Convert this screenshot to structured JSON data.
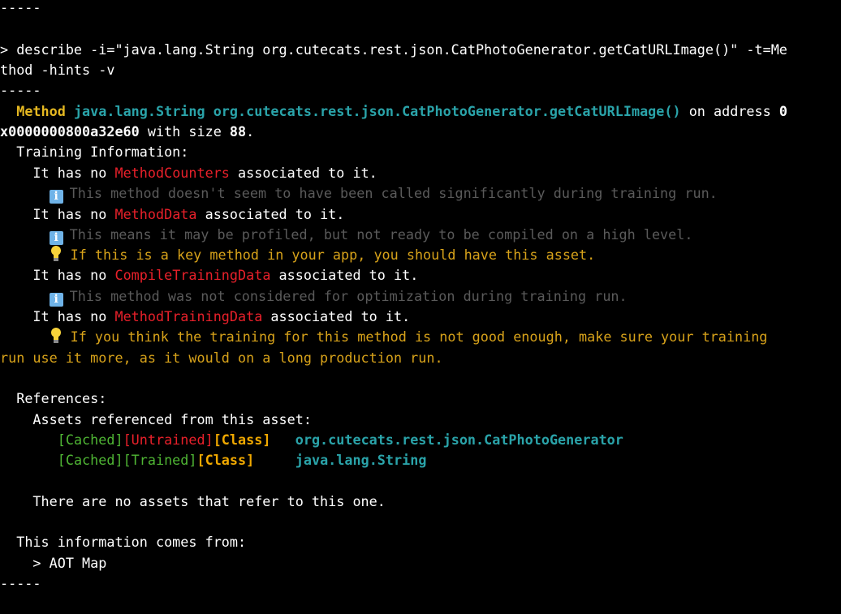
{
  "colors": {
    "background": "#000000",
    "text": "#ffffff",
    "method_keyword": "#e5b821",
    "method_name": "#2aa3a9",
    "missing_asset": "#e8202a",
    "cached_trained": "#4fb534",
    "class_tag": "#f0a800",
    "hint_text": "#5a5a5a",
    "tip_text": "#d7a21a"
  },
  "icons": {
    "info": "info-icon",
    "tip": "lightbulb-icon"
  },
  "separator_top": "-----",
  "command": {
    "line1": "> describe -i=\"java.lang.String org.cutecats.rest.json.CatPhotoGenerator.getCatURLImage()\" -t=Me",
    "line2": "thod -hints -v"
  },
  "separator_mid": "-----",
  "header": {
    "method_keyword": "Method",
    "method_signature": "java.lang.String org.cutecats.rest.json.CatPhotoGenerator.getCatURLImage()",
    "on_address_text": " on address ",
    "address_part1": "0",
    "address_part2": "x0000000800a32e60",
    "with_size_text": " with size ",
    "size": "88",
    "period": "."
  },
  "training": {
    "title": "Training Information:",
    "it_has_no": "It has no ",
    "associated": " associated to it.",
    "method_counters": {
      "name": "MethodCounters",
      "info": "This method doesn't seem to have been called significantly during training run."
    },
    "method_data": {
      "name": "MethodData",
      "info": "This means it may be profiled, but not ready to be compiled on a high level.",
      "tip": "If this is a key method in your app, you should have this asset."
    },
    "compile_training_data": {
      "name": "CompileTrainingData",
      "info": "This method was not considered for optimization during training run."
    },
    "method_training_data": {
      "name": "MethodTrainingData",
      "tip_line1": "If you think the training for this method is not good enough, make sure your training",
      "tip_line2": "run use it more, as it would on a long production run."
    }
  },
  "references": {
    "title": "References:",
    "subtitle": "Assets referenced from this asset:",
    "items": [
      {
        "cached": "[Cached]",
        "training": "[Untrained]",
        "training_status": "untrained",
        "kind": "[Class]",
        "name": "org.cutecats.rest.json.CatPhotoGenerator"
      },
      {
        "cached": "[Cached]",
        "training": "[Trained]",
        "training_status": "trained",
        "kind": "[Class]",
        "name": "java.lang.String"
      }
    ],
    "none_refer": "There are no assets that refer to this one."
  },
  "source": {
    "title": "This information comes from:",
    "item": "> AOT Map"
  },
  "separator_bottom": "-----"
}
